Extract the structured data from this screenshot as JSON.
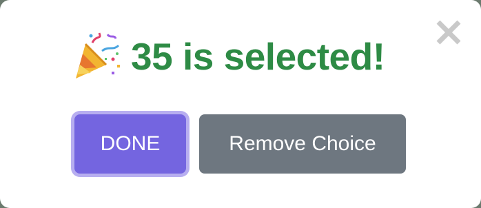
{
  "dialog": {
    "title": "35 is selected!",
    "emoji_icon": "party-popper-icon",
    "close_icon": "close-icon",
    "title_color": "#2e8b45",
    "buttons": {
      "done_label": "DONE",
      "remove_label": "Remove Choice"
    },
    "colors": {
      "done_button": "#7465e0",
      "done_focus_ring": "#b7aef0",
      "remove_button": "#6e7780",
      "close_icon": "#c9c9c9"
    }
  }
}
